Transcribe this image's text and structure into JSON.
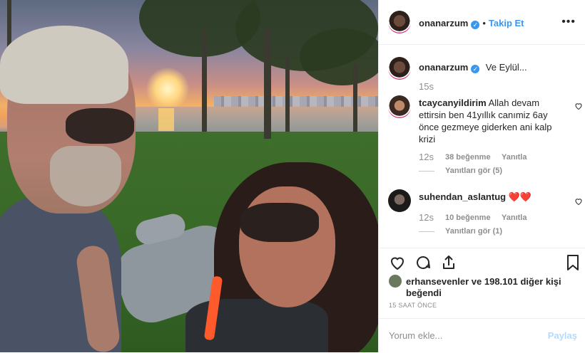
{
  "header": {
    "username": "onanarzum",
    "verified_badge": "✓",
    "separator": "•",
    "follow_label": "Takip Et",
    "more_icon": "•••"
  },
  "caption": {
    "username": "onanarzum",
    "text": "Ve Eylül...",
    "time": "15s"
  },
  "comments": [
    {
      "username": "tcaycanyildirim",
      "text": "Allah devam ettirsin ben 41yıllık canımiz 6ay önce gezmeye giderken ani kalp krizi",
      "time": "12s",
      "likes": "38 beğenme",
      "reply": "Yanıtla",
      "view_replies": "Yanıtları gör (5)"
    },
    {
      "username": "suhendan_aslantug",
      "text": "❤️❤️",
      "time": "12s",
      "likes": "10 beğenme",
      "reply": "Yanıtla",
      "view_replies": "Yanıtları gör (1)"
    }
  ],
  "actions": {
    "like_icon": "heart-icon",
    "comment_icon": "comment-icon",
    "share_icon": "share-icon",
    "save_icon": "bookmark-icon"
  },
  "likes": {
    "first_user": "erhansevenler",
    "rest": "ve 198.101 diğer kişi",
    "suffix": "beğendi"
  },
  "post_time": "15 SAAT ÖNCE",
  "comment_input": {
    "placeholder": "Yorum ekle...",
    "share_label": "Paylaş"
  },
  "colors": {
    "accent": "#3897f0",
    "share_disabled": "#b3dbff",
    "muted": "#8e8e8e"
  }
}
